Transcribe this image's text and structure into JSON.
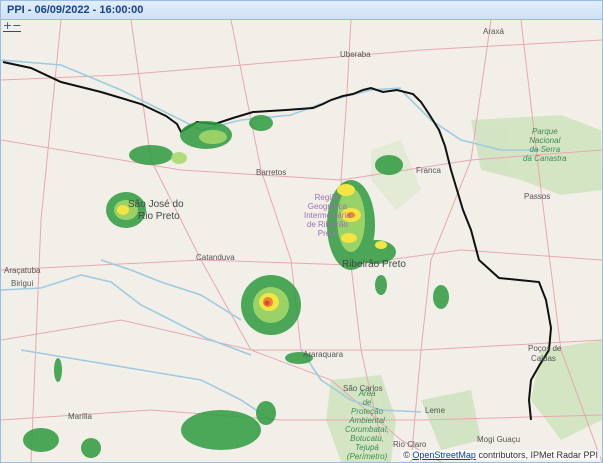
{
  "window": {
    "title": "PPI - 06/09/2022 - 16:00:00"
  },
  "map": {
    "zoom_control": "+−",
    "attribution": {
      "prefix": "©",
      "link": "OpenStreetMap",
      "suffix": "contributors, IPMet Radar PPI"
    },
    "cities": {
      "uberaba": "Uberaba",
      "araxa": "Araxá",
      "franca": "Franca",
      "passos": "Passos",
      "barretos": "Barretos",
      "sjrp_line1": "São José do",
      "sjrp_line2": "Rio Preto",
      "catanduva": "Catanduva",
      "ribeirao": "Ribeirão Preto",
      "aracatuba": "Araçatuba",
      "birigui": "Birigui",
      "araraquara": "Araraquara",
      "sao_carlos": "São Carlos",
      "leme": "Leme",
      "marilia": "Marília",
      "rio_claro": "Rio Claro",
      "mogi_guacu": "Mogi Guaçu",
      "pocos_line1": "Poços de",
      "pocos_line2": "Caldas"
    },
    "region_label": [
      "Região",
      "Geográfica",
      "Intermediária",
      "de Ribeirão",
      "Preto"
    ],
    "park_labels": {
      "serra_canastra": [
        "Parque",
        "Nacional",
        "da Serra",
        "da Canastra"
      ],
      "corumbatai": [
        "Área",
        "de",
        "Proteção",
        "Ambiental",
        "Corumbataí,",
        "Botucatu,",
        "Tejupá",
        "(Perímetro)"
      ]
    },
    "colors": {
      "land": "#f2efe9",
      "river": "#aad3df",
      "road": "#e8a0a8",
      "border": "#111111",
      "radar_low": "#2e9b3e",
      "radar_mid": "#f4e542",
      "radar_high": "#d9482b"
    }
  }
}
